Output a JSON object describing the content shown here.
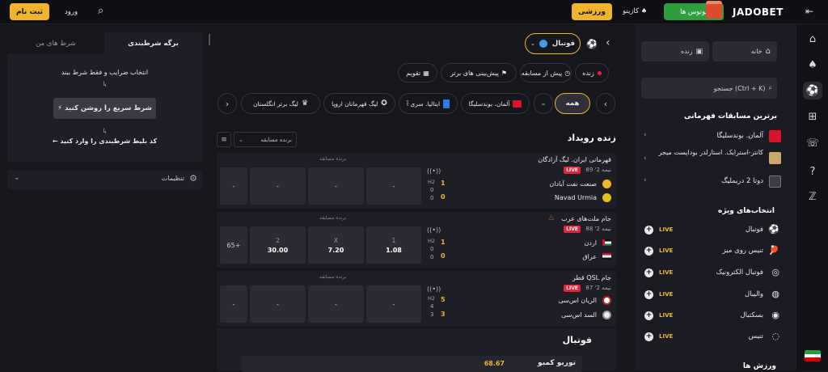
{
  "header": {
    "brand": "JADOBET",
    "bonuses": "بونوس ها",
    "casino": "کازینو",
    "sports": "ورزشی",
    "login": "ورود",
    "register": "ثبت نام",
    "menu_glyph": "⇤",
    "search_glyph": "⌕",
    "bonus_glyph": "🎁",
    "casino_glyph": "♠",
    "sports_glyph": "⚽"
  },
  "rail": [
    {
      "name": "home-icon",
      "glyph": "⌂"
    },
    {
      "name": "spade-icon",
      "glyph": "♠"
    },
    {
      "name": "football-icon",
      "glyph": "⚽"
    },
    {
      "name": "gift-icon",
      "glyph": "⊞"
    },
    {
      "name": "chat-icon",
      "glyph": "☏"
    },
    {
      "name": "help-icon",
      "glyph": "?"
    },
    {
      "name": "z-icon",
      "glyph": "ℤ"
    }
  ],
  "lnav": {
    "home": "خانه",
    "live": "زنده",
    "search_placeholder": "جستجو (Ctrl + K)",
    "top_title": "برترین مسابقات قهرمانی",
    "top": [
      {
        "label": "آلمان. بوندسلیگا"
      },
      {
        "label": "کانتر-استرایک. استارلدر بوداپست میجر"
      },
      {
        "label": "دوتا 2 دریملیگ"
      }
    ],
    "special_title": "انتخاب‌های ویژه",
    "special": [
      {
        "label": "فوتبال",
        "live": "LIVE",
        "glyph": "⚽"
      },
      {
        "label": "تنیس روی میز",
        "live": "LIVE",
        "glyph": "🏓"
      },
      {
        "label": "فوتبال الکترونیک",
        "live": "LIVE",
        "glyph": "◎"
      },
      {
        "label": "والیبال",
        "live": "LIVE",
        "glyph": "◍"
      },
      {
        "label": "بسکتبال",
        "live": "LIVE",
        "glyph": "◉"
      },
      {
        "label": "تنیس",
        "live": "LIVE",
        "glyph": "◌"
      }
    ],
    "sports_title": "ورزش ها"
  },
  "main": {
    "back": "‹",
    "sport_label": "فوتبال",
    "tabs": [
      {
        "label": "زنده"
      },
      {
        "label": "پیش از مسابقه"
      },
      {
        "label": "پیش‌بینی های برتر"
      },
      {
        "label": "تقویم"
      }
    ],
    "filters": {
      "all": "همه",
      "leagues": [
        {
          "label": "آلمان. بوندسلیگا"
        },
        {
          "label": "ایتالیا. سری آ"
        },
        {
          "label": "لیگ قهرمانان اروپا"
        },
        {
          "label": "لیگ برتر انگلستان"
        }
      ]
    },
    "live_title": "زنده رویداد",
    "market_select": "برنده مسابقه",
    "market_label": "برنده مسابقه",
    "events": [
      {
        "league": "قهرمانی ایران. لیگ آزادگان",
        "time": "نیمه 2' 89",
        "live": "LIVE",
        "team1": "صنعت نفت آبادان",
        "team2": "Navad Urmia",
        "score1": "1",
        "score2": "0",
        "h2a": "0",
        "h2b": "0",
        "period": "H2",
        "odds": [
          {
            "label": "",
            "value": "-"
          },
          {
            "label": "",
            "value": "-"
          },
          {
            "label": "",
            "value": "-"
          }
        ],
        "more": "-"
      },
      {
        "league": "جام ملت‌های عرب",
        "time": "نیمه 2' 88",
        "live": "LIVE",
        "team1": "اردن",
        "team2": "عراق",
        "score1": "1",
        "score2": "0",
        "h2a": "0",
        "h2b": "0",
        "period": "H2",
        "odds": [
          {
            "label": "1",
            "value": "1.08"
          },
          {
            "label": "X",
            "value": "7.20"
          },
          {
            "label": "2",
            "value": "30.00"
          }
        ],
        "more": "65+"
      },
      {
        "league": "قطر QSL جام",
        "time": "نیمه 2' 87",
        "live": "LIVE",
        "team1": "الریان اس‌سی",
        "team2": "السد اس‌سی",
        "score1": "5",
        "score2": "3",
        "h2a": "4",
        "h2b": "3",
        "period": "H2",
        "odds": [
          {
            "label": "",
            "value": "-"
          },
          {
            "label": "",
            "value": "-"
          },
          {
            "label": "",
            "value": "-"
          }
        ],
        "more": "-"
      }
    ],
    "football_title": "فوتبال",
    "turbo_label": "توربو کمبو",
    "turbo_value": "68.67"
  },
  "betslip": {
    "tab_active": "برگه شرطبندی",
    "tab_other": "شرط های من",
    "line1": "انتخاب ضرایب و فقط شرط ببند",
    "or1": "یا",
    "quick": "⚡ شرط سریع را روشن کنید",
    "or2": "یا",
    "code": "← کد بلیط شرطبندی را وارد کنید",
    "settings": "تنظیمات"
  },
  "colors": {
    "accent": "#f0b52c",
    "live": "#e3233b",
    "bonus": "#2e9e3e"
  }
}
